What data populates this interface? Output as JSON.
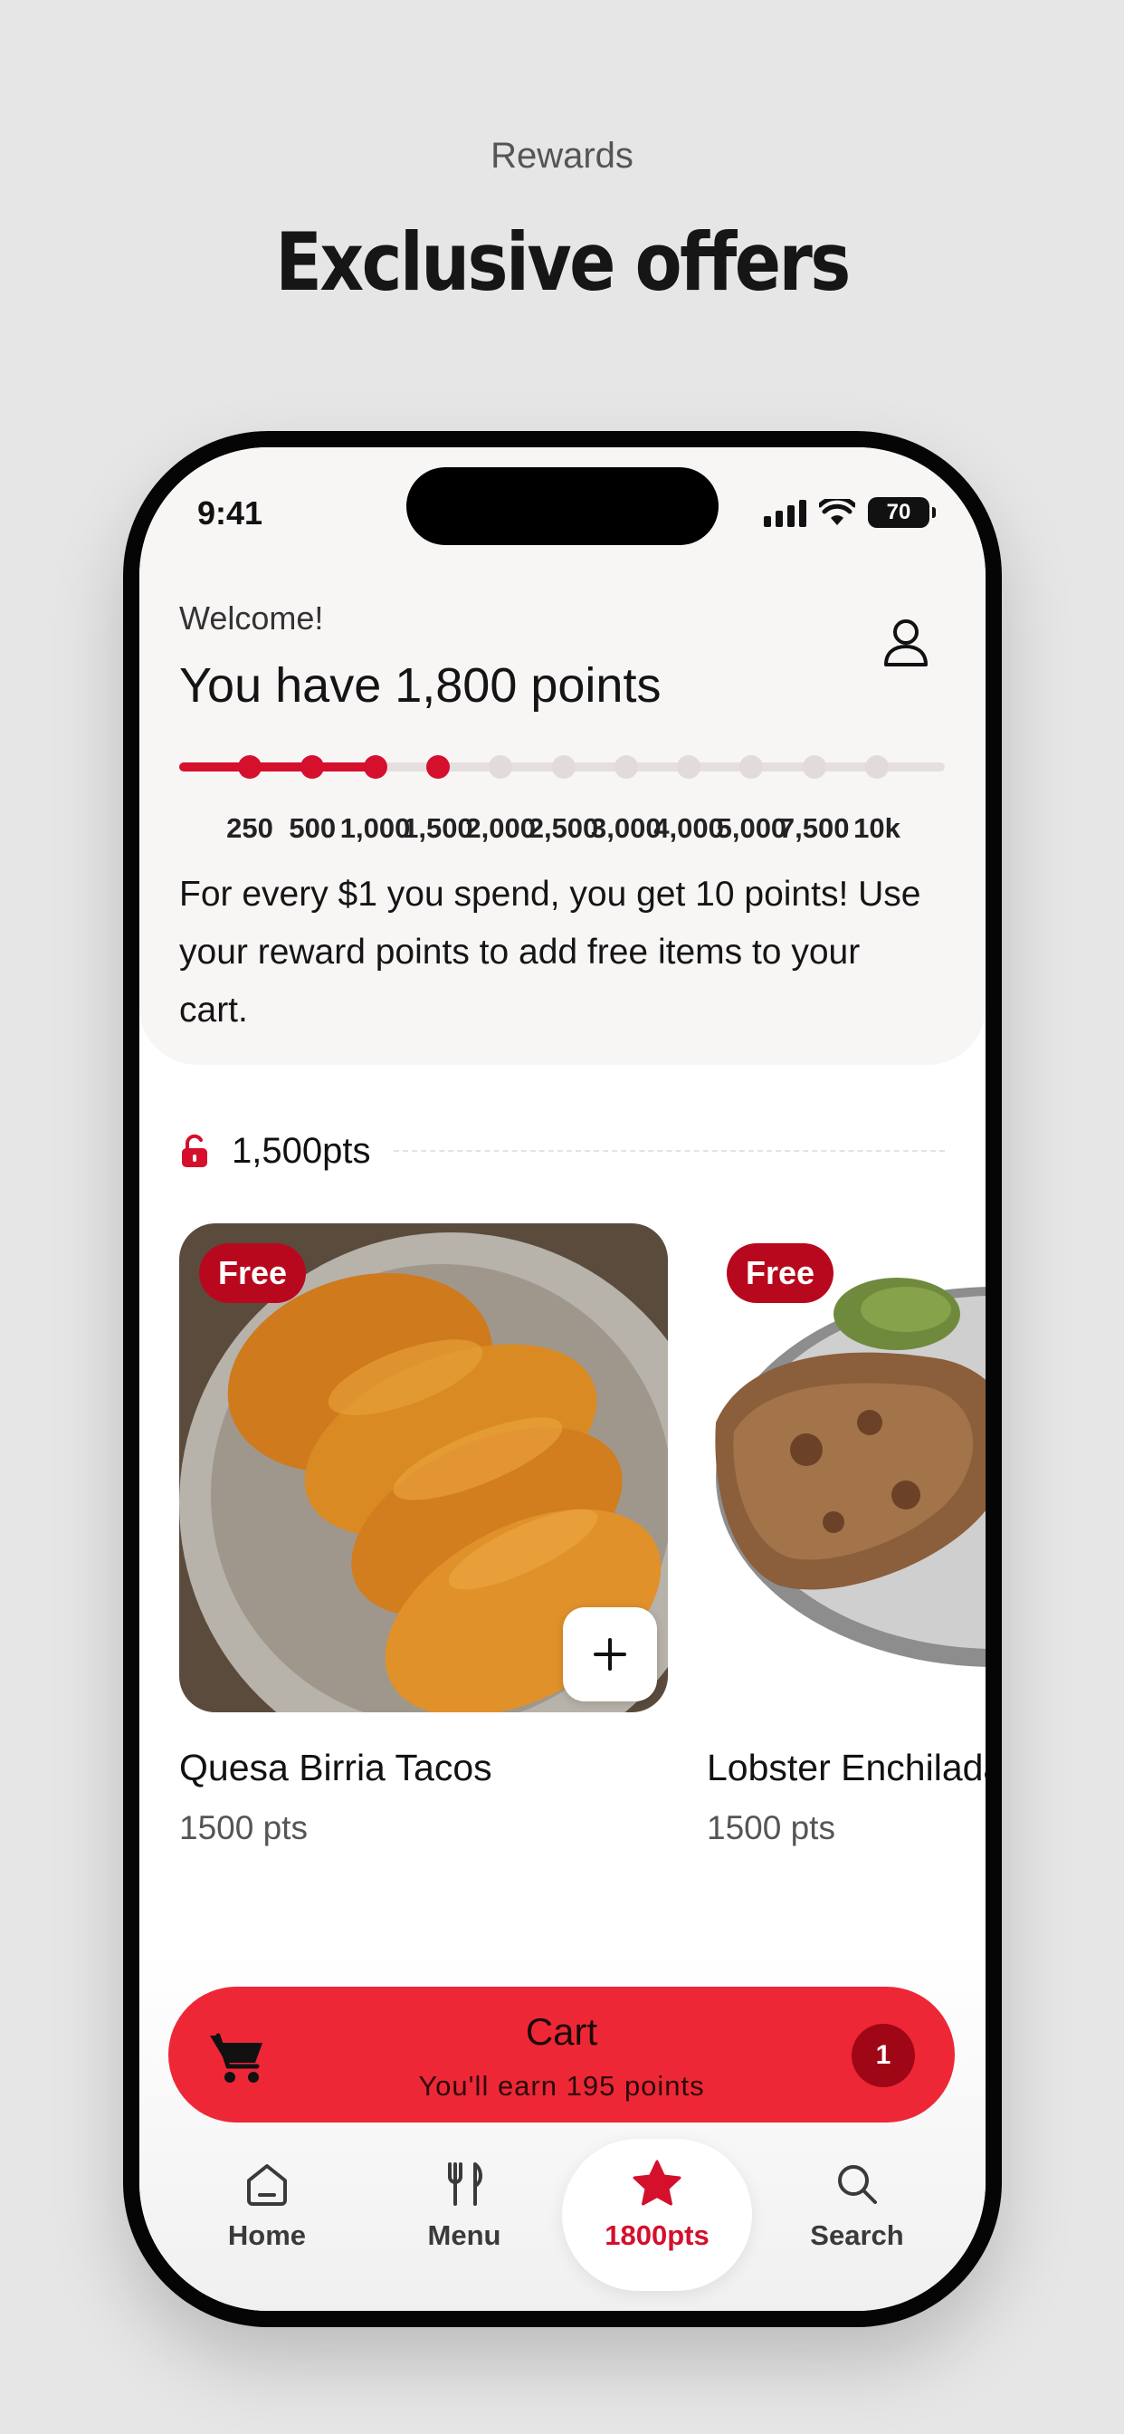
{
  "page": {
    "eyebrow": "Rewards",
    "headline": "Exclusive offers"
  },
  "status_bar": {
    "time": "9:41",
    "battery": "70"
  },
  "rewards": {
    "welcome": "Welcome!",
    "points_title": "You have 1,800 points",
    "current_points": 1800,
    "milestones": [
      "250",
      "500",
      "1,000",
      "1,500",
      "2,000",
      "2,500",
      "3,000",
      "4,000",
      "5,000",
      "7,500",
      "10k"
    ],
    "milestones_reached": 4,
    "description": "For every $1 you spend, you get 10 points! Use your reward points to add free items to your cart."
  },
  "tier": {
    "label": "1,500pts",
    "icon": "unlock-icon"
  },
  "items": [
    {
      "badge": "Free",
      "title": "Quesa Birria Tacos",
      "points": "1500 pts",
      "image": "birria-tacos-photo"
    },
    {
      "badge": "Free",
      "title": "Lobster Enchiladas",
      "points": "1500 pts",
      "image": "enchilada-plate-photo"
    }
  ],
  "cart": {
    "title": "Cart",
    "subtitle": "You'll earn 195 points",
    "count": "1"
  },
  "nav": [
    {
      "label": "Home",
      "icon": "home-icon"
    },
    {
      "label": "Menu",
      "icon": "fork-knife-icon"
    },
    {
      "label": "1800pts",
      "icon": "star-icon",
      "active": true
    },
    {
      "label": "Search",
      "icon": "search-icon"
    }
  ],
  "colors": {
    "accent": "#d4102c",
    "cart_bar": "#ee2737",
    "badge": "#b8081d"
  }
}
